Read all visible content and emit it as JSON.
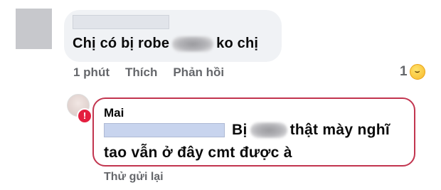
{
  "comment": {
    "text_before": "Chị có bị robe",
    "text_after": "ko chị",
    "actions": {
      "time": "1 phút",
      "like": "Thích",
      "reply": "Phản hồi"
    },
    "reaction_count": "1",
    "reaction_icon": "laughing-emoji-icon"
  },
  "reply": {
    "author": "Mai",
    "line1_before": "Bị",
    "line1_after": "thật mày nghĩ",
    "line2": "tao vẫn ở đây cmt được à",
    "status_icon": "error-exclamation-icon",
    "status_color": "#e41e3f",
    "retry_label": "Thử gửi lại"
  }
}
